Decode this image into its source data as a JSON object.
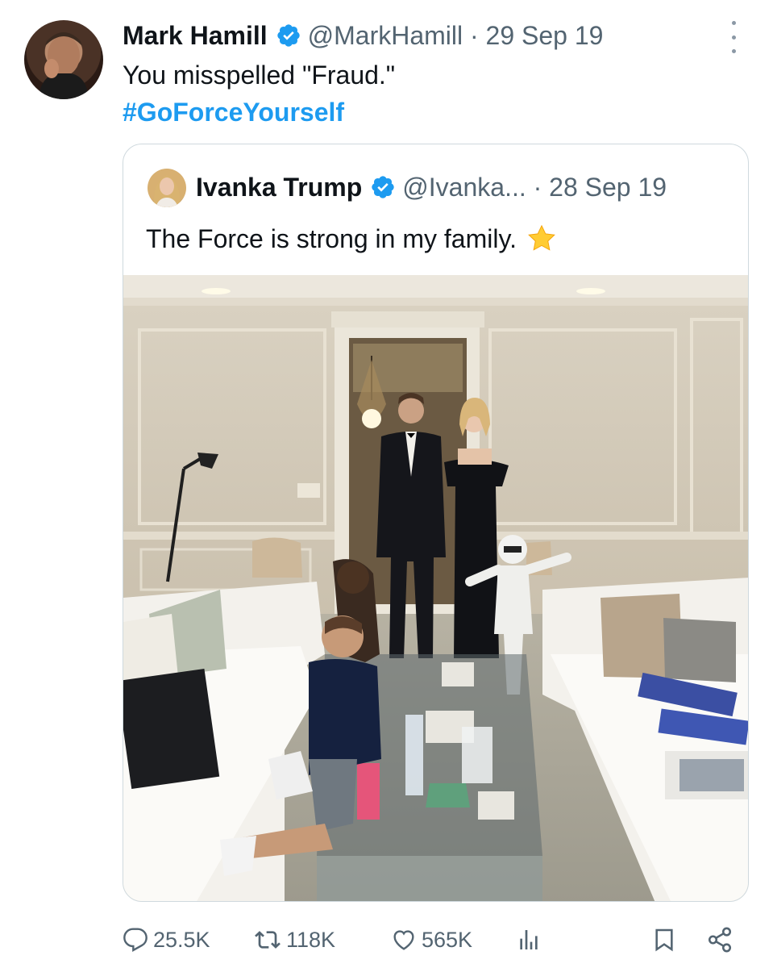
{
  "tweet": {
    "author_name": "Mark Hamill",
    "handle": "@MarkHamill",
    "separator": " · ",
    "date": "29 Sep 19",
    "text": "You misspelled \"Fraud.\"",
    "hashtag": "#GoForceYourself"
  },
  "quoted": {
    "author_name": "Ivanka Trump",
    "handle": "@Ivanka...",
    "separator": " · ",
    "date": "28 Sep 19",
    "text": "The Force is strong in my family.",
    "emoji": "star"
  },
  "actions": {
    "replies": "25.5K",
    "reposts": "118K",
    "likes": "565K"
  },
  "colors": {
    "text": "#0f1419",
    "muted": "#536471",
    "link": "#1d9bf0",
    "verified": "#1d9bf0",
    "border": "#cfd9de"
  },
  "icons": [
    "more-vertical-icon",
    "verified-badge-icon",
    "star-emoji-icon",
    "reply-icon",
    "repost-icon",
    "like-icon",
    "views-icon",
    "bookmark-icon",
    "share-icon"
  ]
}
